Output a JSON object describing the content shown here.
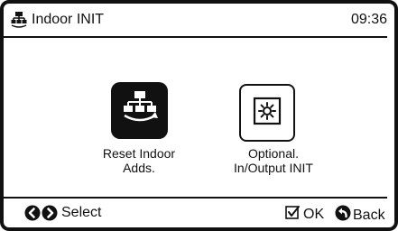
{
  "header": {
    "title": "Indoor INIT",
    "time": "09:36",
    "icon": "indoor-unit-icon"
  },
  "menu": {
    "items": [
      {
        "label_line1": "Reset Indoor",
        "label_line2": "Adds.",
        "icon": "reset-address-icon",
        "selected": true
      },
      {
        "label_line1": "Optional.",
        "label_line2": "In/Output INIT",
        "icon": "optional-io-icon",
        "selected": false
      }
    ]
  },
  "footer": {
    "select_label": "Select",
    "ok_label": "OK",
    "back_label": "Back"
  }
}
